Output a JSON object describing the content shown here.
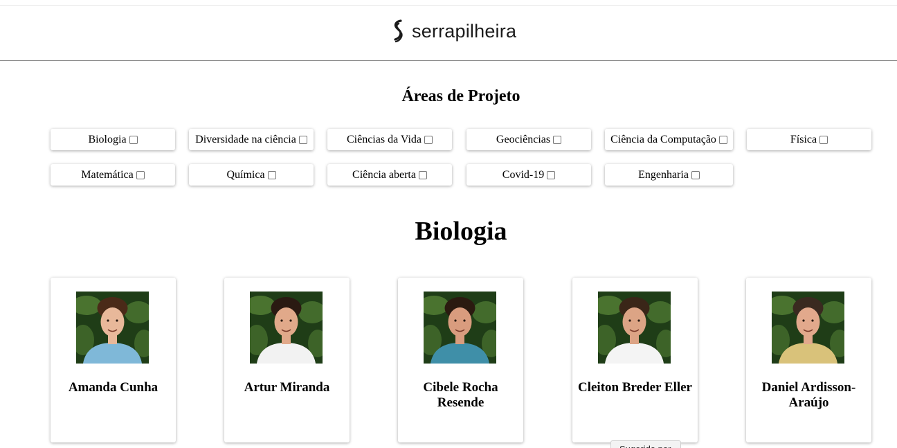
{
  "header": {
    "logo_text": "serrapilheira",
    "logo_icon": "serrapilheira-s-icon"
  },
  "areas": {
    "title": "Áreas de Projeto",
    "filters": [
      {
        "label": "Biologia",
        "checked": false
      },
      {
        "label": "Diversidade na ciência",
        "checked": false
      },
      {
        "label": "Ciências da Vida",
        "checked": false
      },
      {
        "label": "Geociências",
        "checked": false
      },
      {
        "label": "Ciência da Computação",
        "checked": false
      },
      {
        "label": "Física",
        "checked": false
      },
      {
        "label": "Matemática",
        "checked": false
      },
      {
        "label": "Química",
        "checked": false
      },
      {
        "label": "Ciência aberta",
        "checked": false
      },
      {
        "label": "Covid-19",
        "checked": false
      },
      {
        "label": "Engenharia",
        "checked": false
      }
    ]
  },
  "section": {
    "title": "Biologia",
    "people": [
      {
        "name": "Amanda Cunha",
        "shirt": "#7fb8d8",
        "skin": "#e8b89a",
        "hair": "#4a2a18"
      },
      {
        "name": "Artur Miranda",
        "shirt": "#f2f2f2",
        "skin": "#e1a98a",
        "hair": "#2a1a12"
      },
      {
        "name": "Cibele Rocha Resende",
        "shirt": "#3f8fa8",
        "skin": "#d99c7e",
        "hair": "#2b1a10"
      },
      {
        "name": "Cleiton Breder Eller",
        "shirt": "#f4f4f4",
        "skin": "#dca485",
        "hair": "#3a2618"
      },
      {
        "name": "Daniel Ardisson-Araújo",
        "shirt": "#d9c27a",
        "skin": "#e2a98c",
        "hair": "#3a2a20"
      }
    ]
  },
  "tooltip": {
    "text": "Sugerido por"
  },
  "colors": {
    "foliage_dark": "#1f3d17",
    "foliage_light": "#5c8a3a"
  }
}
